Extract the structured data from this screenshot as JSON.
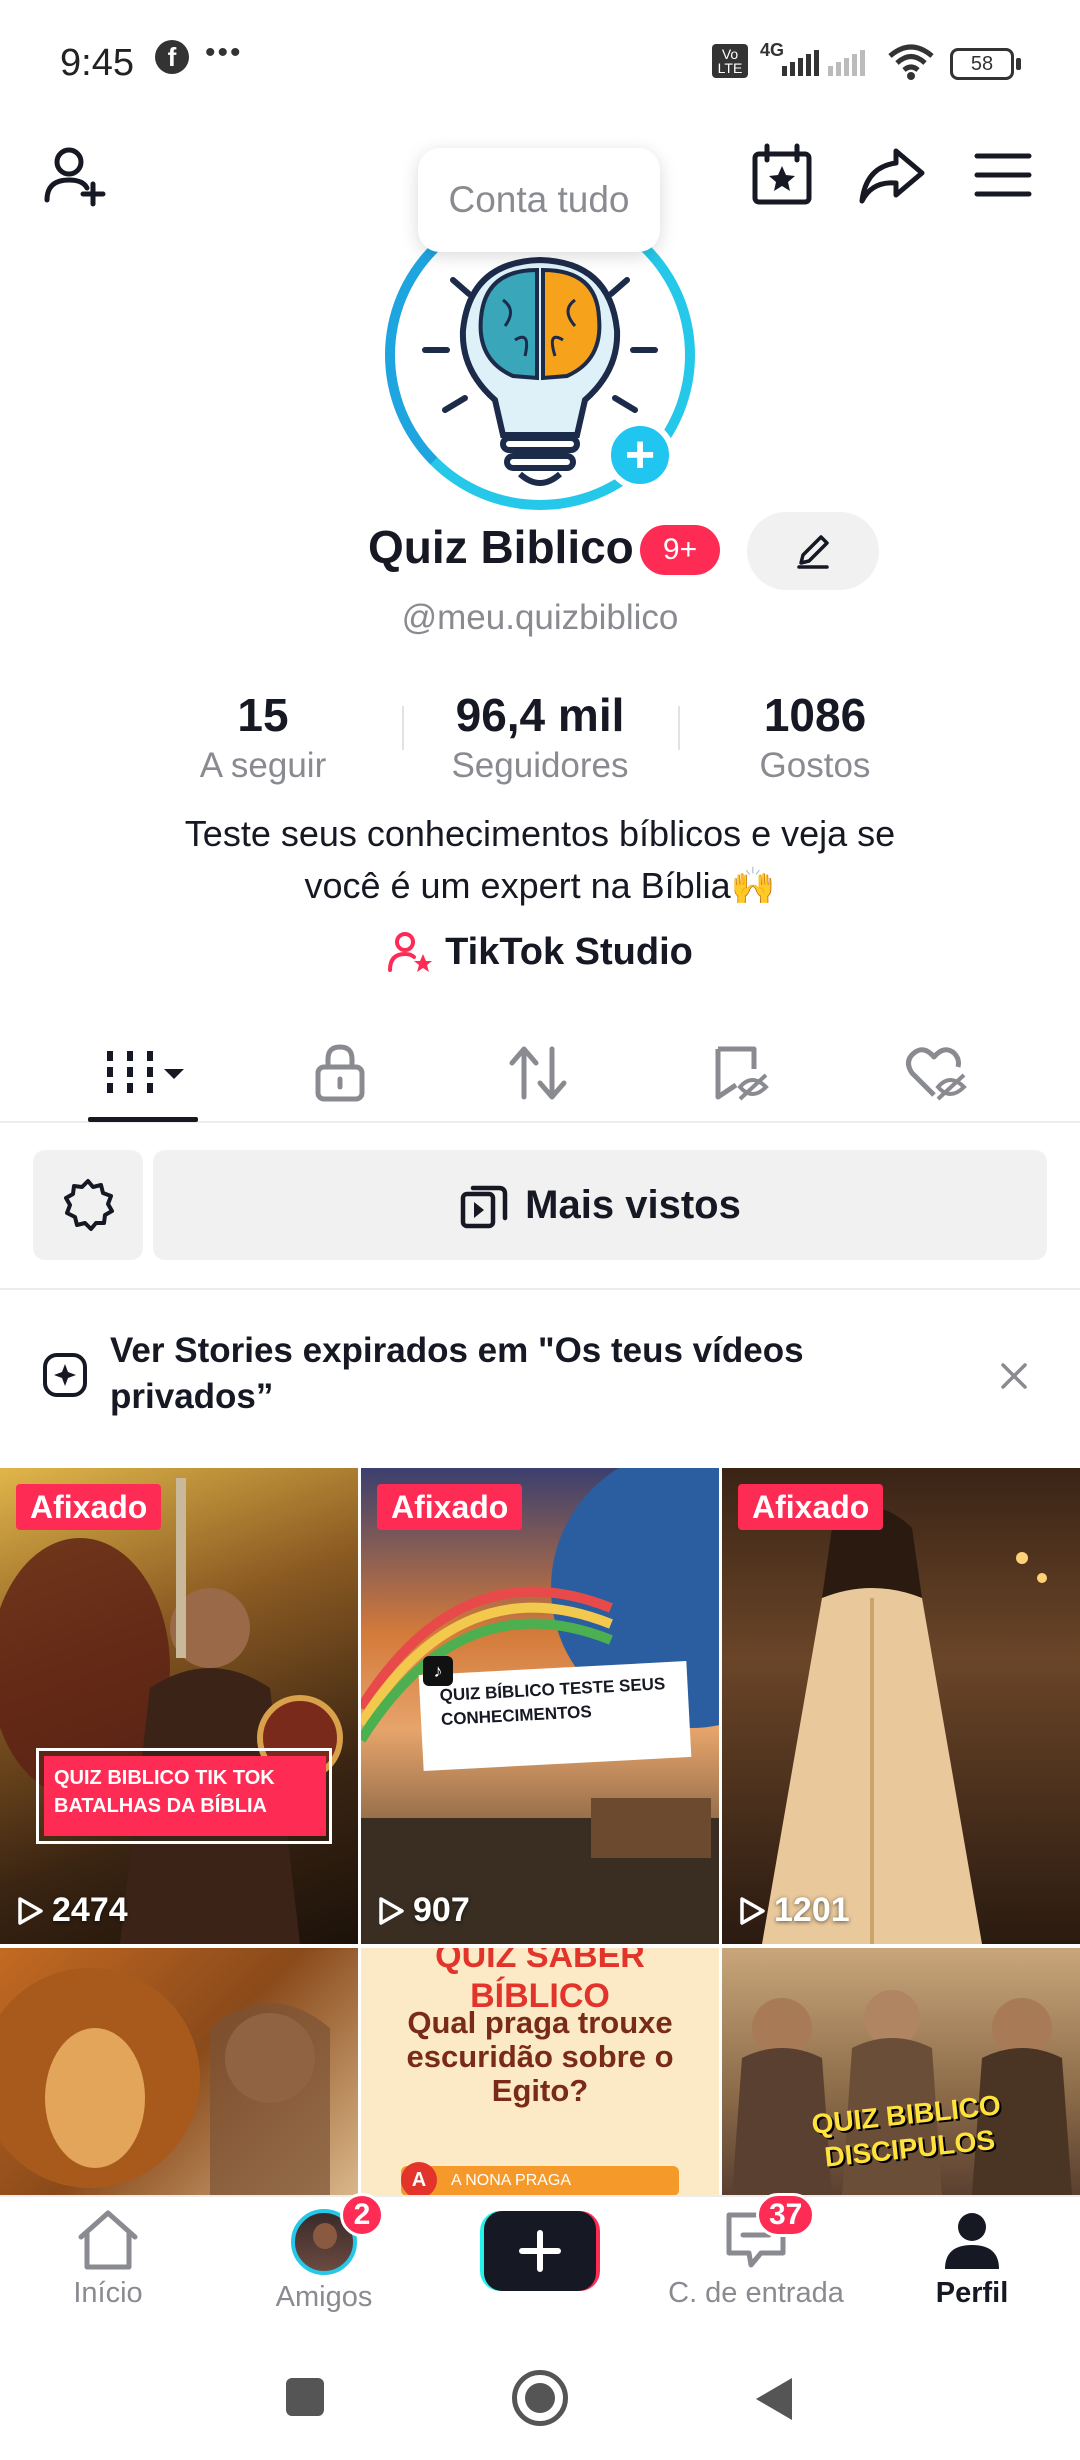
{
  "status_bar": {
    "time": "9:45",
    "more": "•••",
    "network": "4G",
    "volte": "Vo LTE",
    "battery": "58"
  },
  "header": {
    "add_friend_icon": "person-plus-icon",
    "calendar_icon": "calendar-star-icon",
    "share_icon": "share-arrow-icon",
    "menu_icon": "hamburger-menu-icon",
    "tooltip": "Conta tudo"
  },
  "profile": {
    "name": "Quiz Biblico",
    "name_badge": "9+",
    "handle": "@meu.quizbiblico",
    "stats": [
      {
        "value": "15",
        "label": "A seguir"
      },
      {
        "value": "96,4 mil",
        "label": "Seguidores"
      },
      {
        "value": "1086",
        "label": "Gostos"
      }
    ],
    "bio_line1": "Teste seus conhecimentos bíblicos e veja se",
    "bio_line2": "você é um expert na Bíblia🙌",
    "studio_label": "TikTok Studio"
  },
  "tabs": [
    {
      "name": "videos-grid",
      "icon": "grid-bars-icon"
    },
    {
      "name": "private",
      "icon": "lock-icon"
    },
    {
      "name": "reposts",
      "icon": "repost-icon"
    },
    {
      "name": "favorites",
      "icon": "bookmark-hidden-icon"
    },
    {
      "name": "liked",
      "icon": "heart-hidden-icon"
    }
  ],
  "filter": {
    "sort_label": "Mais vistos"
  },
  "banner": {
    "text": "Ver Stories expirados em \"Os teus vídeos privados”"
  },
  "videos": [
    {
      "pinned": "Afixado",
      "views": "2474",
      "overlay": "QUIZ BIBLICO TIK TOK BATALHAS DA BÍBLIA"
    },
    {
      "pinned": "Afixado",
      "views": "907",
      "overlay": "QUIZ BÍBLICO TESTE SEUS CONHECIMENTOS"
    },
    {
      "pinned": "Afixado",
      "views": "1201",
      "overlay": ""
    },
    {
      "pinned": "",
      "views": "",
      "overlay": ""
    },
    {
      "pinned": "",
      "views": "",
      "overlay_title": "QUIZ SABER BÍBLICO",
      "overlay": "Qual praga trouxe escuridão sobre o Egito?",
      "option": "A NONA PRAGA",
      "option_letter": "A"
    },
    {
      "pinned": "",
      "views": "",
      "overlay": "QUIZ BIBLICO DISCIPULOS"
    }
  ],
  "bottom_nav": {
    "home": "Início",
    "friends": "Amigos",
    "friends_badge": "2",
    "inbox": "C. de entrada",
    "inbox_badge": "37",
    "profile": "Perfil"
  },
  "colors": {
    "accent": "#fe2c55",
    "cyan": "#25c8e8",
    "text": "#161823",
    "muted": "#8a8b91"
  }
}
